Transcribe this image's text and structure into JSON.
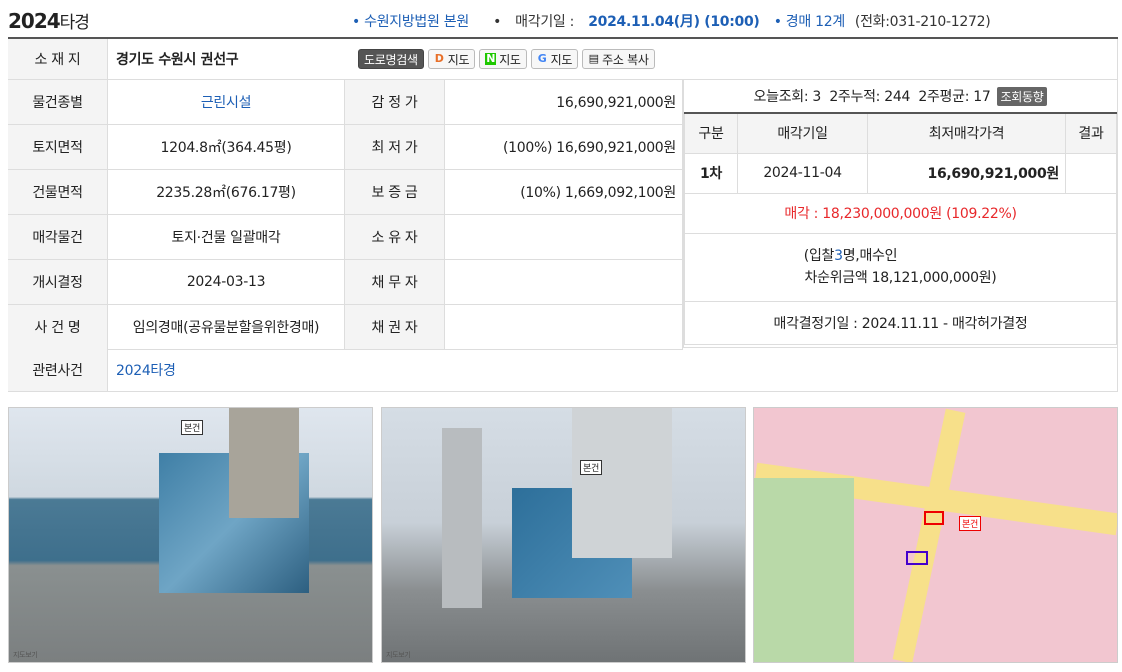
{
  "header": {
    "case_year": "2024",
    "case_type": "타경",
    "court": "수원지방법원 본원",
    "sale_label": "매각기일 : ",
    "sale_date": "2024.11.04(月) (10:00)",
    "dept": "경매 12계",
    "phone": "(전화:031-210-1272)"
  },
  "address": {
    "label": "소 재 지",
    "value": "경기도 수원시 권선구",
    "buttons": [
      "도로명검색",
      "지도",
      "지도",
      "지도",
      "주소 복사"
    ]
  },
  "rows": [
    {
      "l1": "물건종별",
      "v1": "근린시설",
      "l2": "감 정 가",
      "v2": "16,690,921,000원"
    },
    {
      "l1": "토지면적",
      "v1": "1204.8㎡(364.45평)",
      "l2": "최 저 가",
      "v2": "(100%) 16,690,921,000원"
    },
    {
      "l1": "건물면적",
      "v1": "2235.28㎡(676.17평)",
      "l2": "보 증 금",
      "v2": "(10%) 1,669,092,100원"
    },
    {
      "l1": "매각물건",
      "v1": "토지·건물 일괄매각",
      "l2": "소 유 자",
      "v2": ""
    },
    {
      "l1": "개시결정",
      "v1": "2024-03-13",
      "l2": "채 무 자",
      "v2": ""
    },
    {
      "l1": "사 건 명",
      "v1": "임의경매(공유물분할을위한경매)",
      "l2": "채 권 자",
      "v2": ""
    }
  ],
  "related": {
    "label": "관련사건",
    "value": "2024타경"
  },
  "stats": {
    "text": "오늘조회: 3  2주누적: 244  2주평균: 17",
    "button": "조회동향"
  },
  "auction_table": {
    "headers": [
      "구분",
      "매각기일",
      "최저매각가격",
      "결과"
    ],
    "row": [
      "1차",
      "2024-11-04",
      "16,690,921,000원",
      ""
    ],
    "sold_label": "매각 : ",
    "sold_price": "18,230,000,000원",
    "sold_ratio": "(109.22%)",
    "bid_pre": "(입찰",
    "bid_count": "3",
    "bid_post": "명,매수인",
    "second": "차순위금액 18,121,000,000원)",
    "decision": "매각결정기일 : 2024.11.11 - 매각허가결정"
  },
  "photos": {
    "tag1": "본건",
    "tag2": "본건",
    "tag3": "본건"
  },
  "colors": {
    "blue": "#1d5fb5",
    "red": "#e8282b"
  }
}
